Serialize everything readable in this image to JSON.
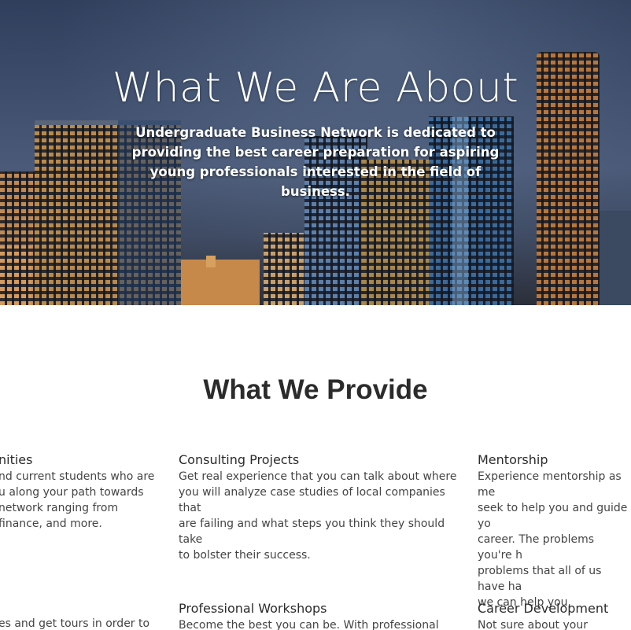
{
  "hero": {
    "title": "What We Are About",
    "subtitle": "Undergraduate Business Network is dedicated to providing the best career preparation for aspiring young professionals interested in the field of business."
  },
  "provide": {
    "title": "What We Provide",
    "cards": [
      {
        "title": "nities",
        "text": "nd current students who are\nu along your path towards\nnetwork ranging from\nfinance, and more."
      },
      {
        "title": "Consulting Projects",
        "text": "Get real experience that you can talk about where\nyou will analyze case studies of local companies that\nare failing and what steps you think they should take\nto bolster their success."
      },
      {
        "title": "Mentorship",
        "text": "Experience mentorship as me\nseek to help you and guide yo\ncareer. The problems you're h\nproblems that all of us have ha\nwe can help you."
      },
      {
        "title": "",
        "text": "es and get tours in order to"
      },
      {
        "title": "Professional Workshops",
        "text": "Become the best you can be. With professional"
      },
      {
        "title": "Career Development",
        "text": "Not sure about your career? W"
      }
    ]
  }
}
